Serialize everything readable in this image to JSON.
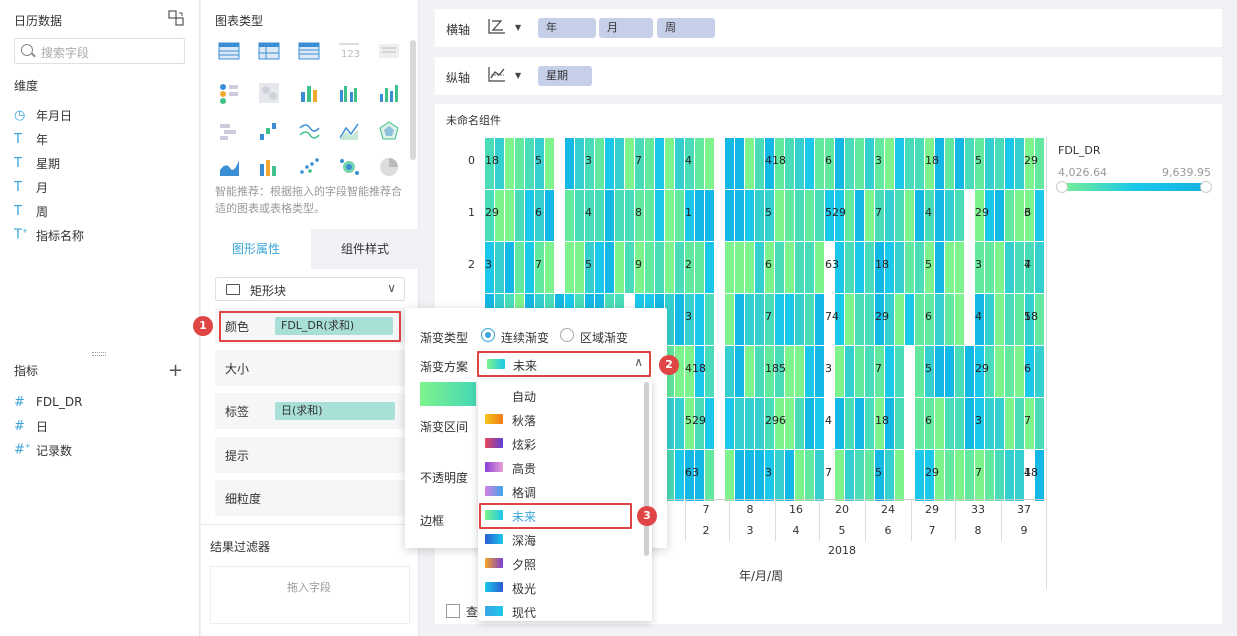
{
  "data_panel": {
    "title": "日历数据",
    "search_placeholder": "搜索字段",
    "dimension_label": "维度",
    "dimensions": [
      {
        "icon": "clock-icon",
        "label": "年月日"
      },
      {
        "icon": "text-T-icon",
        "label": "年"
      },
      {
        "icon": "text-T-icon",
        "label": "星期"
      },
      {
        "icon": "text-T-icon",
        "label": "月"
      },
      {
        "icon": "text-T-icon",
        "label": "周"
      },
      {
        "icon": "text-T-icon",
        "label": "指标名称"
      }
    ],
    "measure_label": "指标",
    "measures": [
      {
        "icon": "hash-icon",
        "label": "FDL_DR"
      },
      {
        "icon": "hash-icon",
        "label": "日"
      },
      {
        "icon": "hash-icon",
        "label": "记录数"
      }
    ]
  },
  "middle_panel": {
    "chart_type_title": "图表类型",
    "hint": "智能推荐：根据拖入的字段智能推荐合适的图表或表格类型。",
    "tabs": [
      "图形属性",
      "组件样式"
    ],
    "shape_select": "矩形块",
    "props": {
      "color": "颜色",
      "color_field": "FDL_DR(求和)",
      "size": "大小",
      "label": "标签",
      "label_field": "日(求和)",
      "tooltip": "提示",
      "granularity": "细粒度"
    },
    "result_filter": "结果过滤器",
    "drop_hint": "拖入字段"
  },
  "axes": {
    "x_label": "横轴",
    "x_fields": [
      "年",
      "月",
      "周"
    ],
    "y_label": "纵轴",
    "y_fields": [
      "星期"
    ]
  },
  "chart": {
    "title": "未命名组件",
    "checkbox_label": "查"
  },
  "chart_data": {
    "type": "heatmap",
    "title": "未命名组件",
    "y_categories": [
      "0",
      "1",
      "2",
      "3",
      "4",
      "5",
      "6"
    ],
    "x_tick_labels_row1": [
      "7",
      "8",
      "16",
      "20",
      "24",
      "29",
      "33",
      "37"
    ],
    "x_tick_labels_row2": [
      "2",
      "3",
      "4",
      "5",
      "6",
      "7",
      "8",
      "9"
    ],
    "x_group_label": "2018",
    "xlabel": "年/月/周",
    "legend": {
      "title": "FDL_DR",
      "min": "4,026.64",
      "max": "9,639.95"
    },
    "cell_labels": [
      [
        "18",
        "5",
        "3",
        "7",
        "4",
        "418",
        "6",
        "3",
        "18",
        "5",
        "29"
      ],
      [
        "29",
        "6",
        "4",
        "8",
        "1",
        "5",
        "529",
        "7",
        "4",
        "29",
        "6",
        "3"
      ],
      [
        "3",
        "7",
        "5",
        "9",
        "2",
        "6",
        "63",
        "18",
        "5",
        "3",
        "7",
        "4"
      ],
      [
        "3",
        "7",
        "74",
        "29",
        "6",
        "4",
        "18",
        "5"
      ],
      [
        "418",
        "185",
        "3",
        "7",
        "5",
        "29",
        "6"
      ],
      [
        "529",
        "296",
        "4",
        "18",
        "6",
        "3",
        "7"
      ],
      [
        "63",
        "3",
        "7",
        "5",
        "29",
        "7",
        "4",
        "18"
      ]
    ]
  },
  "popup": {
    "gradient_type_label": "渐变类型",
    "option_continuous": "连续渐变",
    "option_region": "区域渐变",
    "scheme_label": "渐变方案",
    "scheme_value": "未来",
    "range_label": "渐变区间",
    "opacity_label": "不透明度",
    "border_label": "边框",
    "options": [
      {
        "label": "自动",
        "colors": []
      },
      {
        "label": "秋落",
        "colors": [
          "#f5c518",
          "#f07a1a"
        ]
      },
      {
        "label": "炫彩",
        "colors": [
          "#e8465a",
          "#5a3fd4"
        ]
      },
      {
        "label": "高贵",
        "colors": [
          "#8a3fd4",
          "#e8a0d8"
        ]
      },
      {
        "label": "格调",
        "colors": [
          "#d97fe0",
          "#3aa4e8"
        ]
      },
      {
        "label": "未来",
        "colors": [
          "#7ef28c",
          "#1bc8ea"
        ]
      },
      {
        "label": "深海",
        "colors": [
          "#2a5bd4",
          "#1bc8ea"
        ]
      },
      {
        "label": "夕照",
        "colors": [
          "#f5a623",
          "#7a3fd4"
        ]
      },
      {
        "label": "极光",
        "colors": [
          "#1bc8ea",
          "#2a5bd4"
        ]
      },
      {
        "label": "现代",
        "colors": [
          "#3aa4e8",
          "#1bc8ea"
        ]
      }
    ]
  },
  "badges": [
    "1",
    "2",
    "3"
  ]
}
